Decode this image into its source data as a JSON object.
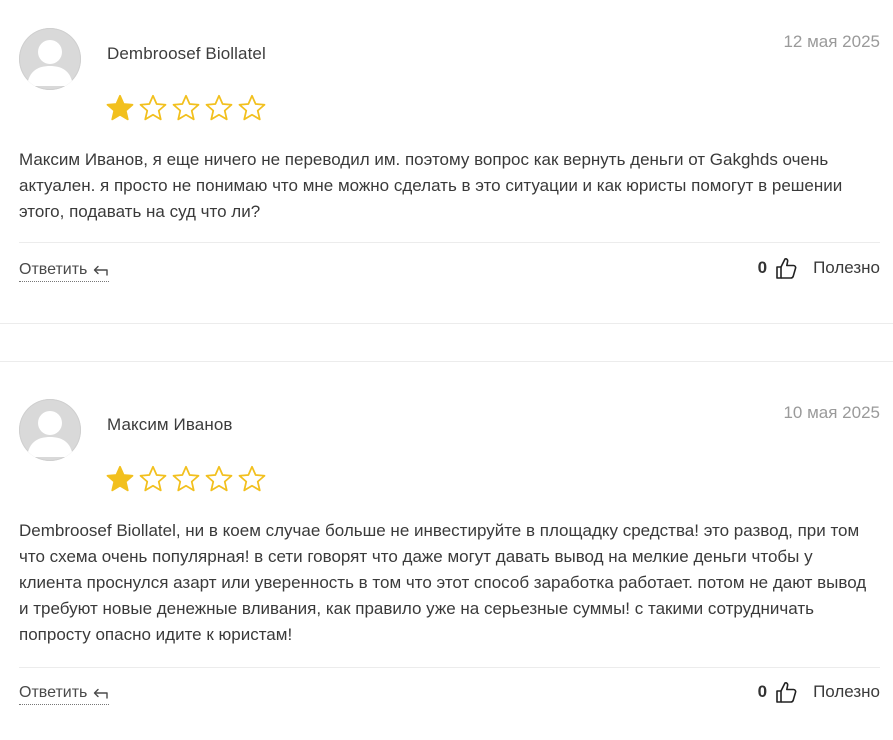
{
  "reviews": [
    {
      "author": "Dembroosef Biollatel",
      "date": "12 мая 2025",
      "rating": 1,
      "max_rating": 5,
      "text": "Максим Иванов, я еще ничего не переводил им. поэтому вопрос как вернуть деньги от Gakghds очень актуален. я просто не понимаю что мне можно сделать в это ситуации и как юристы помогут в решении этого, подавать на суд что ли?",
      "reply_label": "Ответить",
      "helpful_count": "0",
      "helpful_label": "Полезно"
    },
    {
      "author": "Максим Иванов",
      "date": "10 мая 2025",
      "rating": 1,
      "max_rating": 5,
      "text": "Dembroosef Biollatel, ни в коем случае больше не инвестируйте в площадку средства! это развод, при том что схема очень популярная! в сети говорят что даже могут давать вывод на мелкие деньги чтобы у клиента проснулся азарт или уверенность в том что этот способ заработка работает. потом не дают вывод и требуют новые денежные вливания, как правило уже на серьезные суммы! с такими сотрудничать попросту опасно идите к юристам!",
      "reply_label": "Ответить",
      "helpful_count": "0",
      "helpful_label": "Полезно"
    }
  ],
  "colors": {
    "star_filled": "#F2C01E",
    "star_empty_outline": "#F2C01E",
    "avatar_bg": "#D9D9D9",
    "date_text": "#9A9A9A"
  },
  "icons": {
    "avatar": "user-avatar-placeholder-icon",
    "star": "star-icon",
    "reply": "reply-arrow-icon",
    "thumb": "thumbs-up-icon"
  }
}
